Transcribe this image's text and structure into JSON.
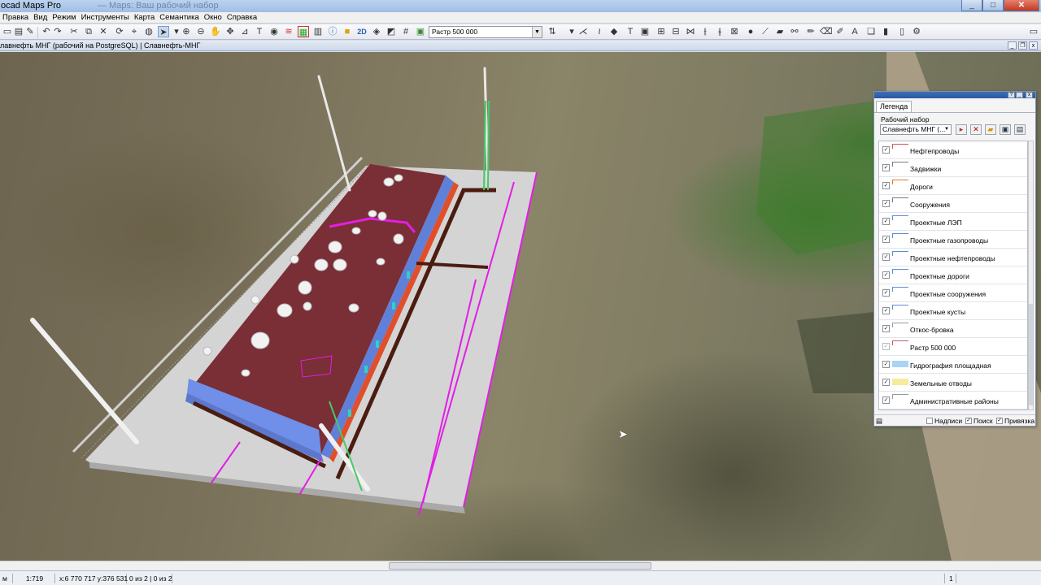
{
  "window": {
    "title": "ocad Maps Pro",
    "title_ghost": "— Maps: Ваш рабочий набор"
  },
  "menu": [
    "Правка",
    "Вид",
    "Режим",
    "Инструменты",
    "Карта",
    "Семантика",
    "Окно",
    "Справка"
  ],
  "toolbar": {
    "scale_value": "Растр 500 000",
    "labels": {
      "view2d": "2D"
    }
  },
  "map_window": {
    "title": "лавнефть МНГ (рабочий на PostgreSQL) | Славнефть-МНГ"
  },
  "legend": {
    "tab": "Легенда",
    "workset_label": "Рабочий набор",
    "workset_value": "Славнефть МНГ (...",
    "layers": [
      {
        "label": "Нефтепроводы",
        "checked": true,
        "swatch": "#e05050"
      },
      {
        "label": "Задвижки",
        "checked": true,
        "swatch": "#7a7a7a"
      },
      {
        "label": "Дороги",
        "checked": true,
        "swatch": "#e6762e"
      },
      {
        "label": "Сооружения",
        "checked": true,
        "swatch": "#7a7a7a"
      },
      {
        "label": "Проектные ЛЭП",
        "checked": true,
        "swatch": "#5b8fd6"
      },
      {
        "label": "Проектные газопроводы",
        "checked": true,
        "swatch": "#5b8fd6"
      },
      {
        "label": "Проектные нефтепроводы",
        "checked": true,
        "swatch": "#5b8fd6"
      },
      {
        "label": "Проектные дороги",
        "checked": true,
        "swatch": "#5b8fd6"
      },
      {
        "label": "Проектные сооружения",
        "checked": true,
        "swatch": "#5b8fd6"
      },
      {
        "label": "Проектные кусты",
        "checked": true,
        "swatch": "#5b8fd6"
      },
      {
        "label": "Откос-бровка",
        "checked": true,
        "swatch": "#9a9a9a"
      },
      {
        "label": "Растр 500 000",
        "checked": false,
        "swatch": "#c46060"
      },
      {
        "label": "Гидрография площадная",
        "checked": true,
        "swatch": "#a9d4f5"
      },
      {
        "label": "Земельные отводы",
        "checked": true,
        "swatch": "#f3ec9a"
      },
      {
        "label": "Административные районы",
        "checked": true,
        "swatch": "#9a9a9a"
      }
    ],
    "footer": {
      "labels": {
        "label": "Надписи",
        "checked": false
      },
      "search": {
        "label": "Поиск",
        "checked": true
      },
      "snap": {
        "label": "Привязка",
        "checked": true
      }
    }
  },
  "status": {
    "mode": "м",
    "scale": "1:719",
    "coords": "x:6 770 717 y:376 531",
    "selection": "0 из 2 | 0 из 2",
    "page": "1"
  },
  "colors": {
    "roof": "#7a2e35",
    "wall": "#6f8fe8",
    "pad": "#d6d6d6",
    "magenta": "#e21ee6",
    "accent_green": "#46c86a"
  }
}
